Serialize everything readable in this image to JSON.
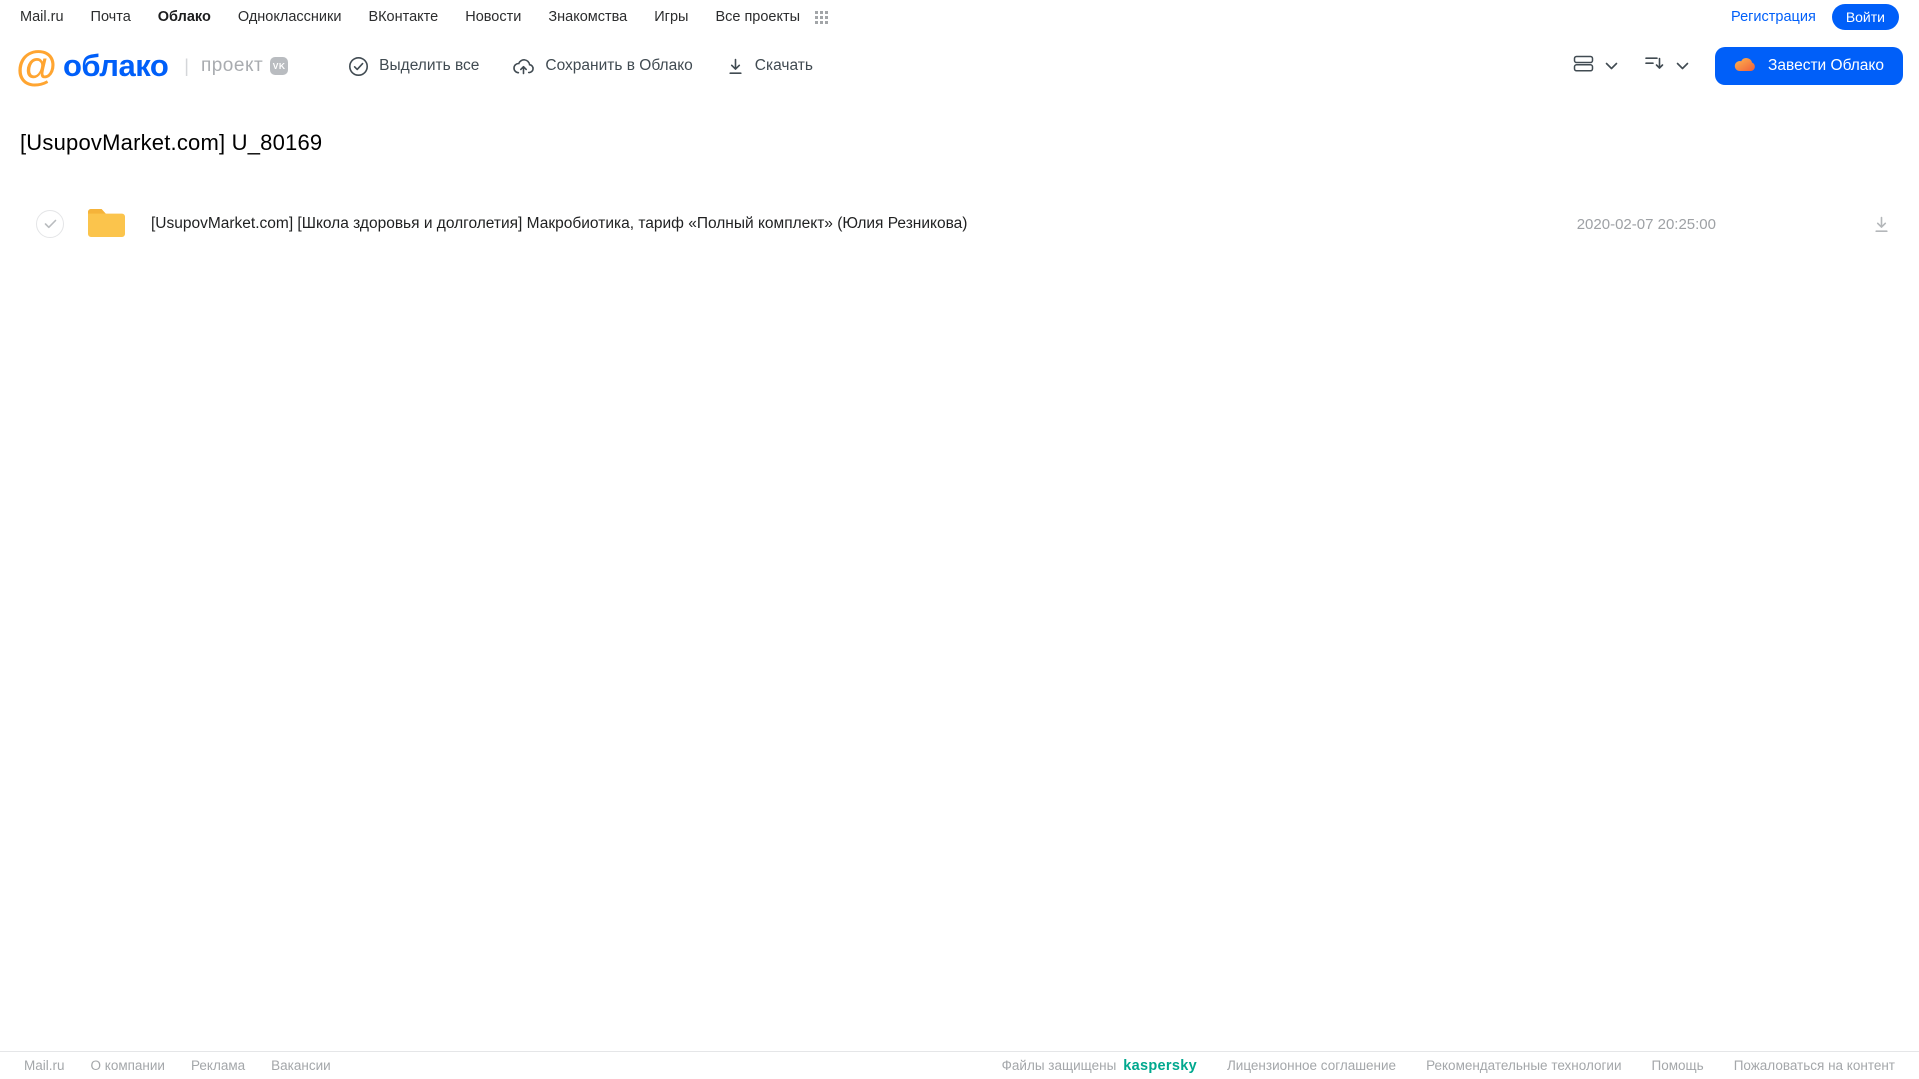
{
  "topbar": {
    "links": [
      "Mail.ru",
      "Почта",
      "Облако",
      "Одноклассники",
      "ВКонтакте",
      "Новости",
      "Знакомства",
      "Игры",
      "Все проекты"
    ],
    "active_link": "Облако",
    "grid_icon": "apps-grid-icon",
    "registration_label": "Регистрация",
    "login_label": "Войти"
  },
  "header": {
    "logo_at": "@",
    "logo_text": "облако",
    "project_label": "проект",
    "vk_badge": "VK",
    "toolbar": [
      {
        "label": "Выделить все",
        "icon": "check-circle-icon"
      },
      {
        "label": "Сохранить в Облако",
        "icon": "cloud-upload-icon"
      },
      {
        "label": "Скачать",
        "icon": "download-icon"
      }
    ],
    "view_control_icon": "view-mode-icon",
    "sort_control_icon": "sort-icon",
    "create_cloud_label": "Завести Облако"
  },
  "main": {
    "title": "[UsupovMarket.com] U_80169",
    "files": [
      {
        "type": "folder",
        "name": "[UsupovMarket.com] [Школа здоровья и долголетия] Макробиотика, тариф «Полный комплект» (Юлия Резникова)",
        "date": "2020-02-07 20:25:00"
      }
    ]
  },
  "footer": {
    "left_links": [
      "Mail.ru",
      "О компании",
      "Реклама",
      "Вакансии"
    ],
    "protected_label": "Файлы защищены",
    "kaspersky_label": "kaspersky",
    "right_links": [
      "Лицензионное соглашение",
      "Рекомендательные технологии",
      "Помощь",
      "Пожаловаться на контент"
    ]
  },
  "colors": {
    "accent_blue": "#005ff9",
    "logo_orange": "#ffa531",
    "folder_yellow": "#fbc44c",
    "folder_tab": "#f5b33a",
    "kaspersky_teal": "#00a88e",
    "toolbar_icon": "#414b52",
    "muted_grey": "#9ea1a5"
  }
}
